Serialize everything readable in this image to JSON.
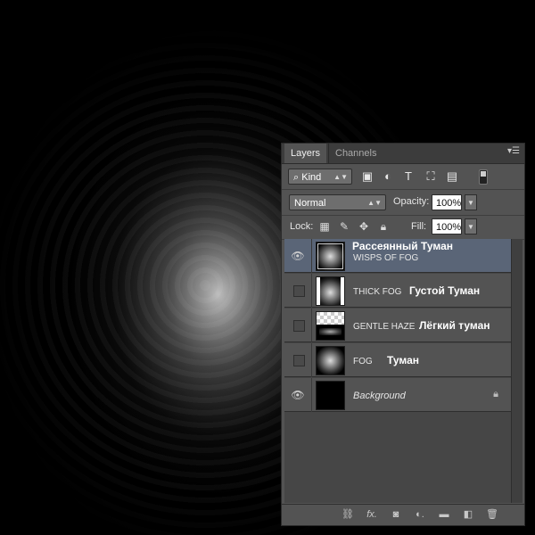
{
  "panel": {
    "tabs": [
      "Layers",
      "Channels"
    ],
    "menu_icon": "panel-menu-icon"
  },
  "filter": {
    "kind_label": "Kind",
    "icons": [
      "search-icon",
      "image-filter-icon",
      "adjustment-filter-icon",
      "type-filter-icon",
      "shape-filter-icon",
      "smart-object-filter-icon"
    ]
  },
  "blend": {
    "mode": "Normal",
    "opacity_label": "Opacity:",
    "opacity_value": "100%"
  },
  "lock": {
    "label": "Lock:",
    "fill_label": "Fill:",
    "fill_value": "100%"
  },
  "layers": [
    {
      "name": "WISPS OF FOG",
      "ru": "Рассеянный Туман",
      "visible": true,
      "selected": true,
      "thumb": "cloud"
    },
    {
      "name": "THICK FOG",
      "ru": "Густой Туман",
      "visible": false,
      "selected": false,
      "thumb": "thick"
    },
    {
      "name": "GENTLE HAZE",
      "ru": "Лёгкий туман",
      "visible": false,
      "selected": false,
      "thumb": "haze"
    },
    {
      "name": "FOG",
      "ru": "Туман",
      "visible": false,
      "selected": false,
      "thumb": "cloud"
    },
    {
      "name": "Background",
      "ru": "",
      "visible": true,
      "selected": false,
      "thumb": "black",
      "locked": true
    }
  ],
  "bottom_icons": [
    "link-layers-icon",
    "fx-icon",
    "layer-mask-icon",
    "adjustment-layer-icon",
    "new-group-icon",
    "new-layer-icon",
    "trash-icon"
  ],
  "colors": {
    "panel_bg": "#535353",
    "selected_layer": "#5a6577"
  }
}
